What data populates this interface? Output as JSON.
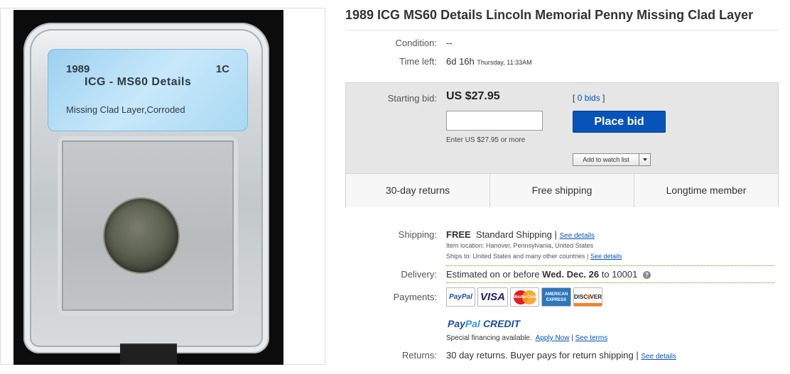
{
  "listing": {
    "title": "1989 ICG MS60 Details Lincoln Memorial Penny Missing Clad Layer"
  },
  "photo": {
    "label_year": "1989",
    "label_denomination": "1C",
    "label_grade": "ICG - MS60 Details",
    "label_note": "Missing Clad Layer,Corroded"
  },
  "condition": {
    "label": "Condition:",
    "value": "--"
  },
  "time_left": {
    "label": "Time left:",
    "value": "6d 16h",
    "end": "Thursday, 11:33AM"
  },
  "bid": {
    "label": "Starting bid:",
    "price": "US $27.95",
    "input_value": "",
    "hint": "Enter US $27.95 or more",
    "bids_open": "[",
    "bids_link": "0 bids",
    "bids_close": "]",
    "place_bid_label": "Place bid",
    "watch_label": "Add to watch list"
  },
  "features": [
    "30-day returns",
    "Free shipping",
    "Longtime member"
  ],
  "shipping": {
    "label": "Shipping:",
    "cost": "FREE",
    "method": "Standard Shipping |",
    "details_link": "See details",
    "location": "Item location:  Hanover, Pennsylvania, United States",
    "ships_to": "Ships to:  United States and many other countries |",
    "ships_to_link": "See details"
  },
  "delivery": {
    "label": "Delivery:",
    "prefix": "Estimated on or before",
    "date": "Wed. Dec. 26",
    "suffix": "to 10001",
    "help_icon": "?"
  },
  "payments": {
    "label": "Payments:",
    "cards": {
      "paypal": "PayPal",
      "visa": "VISA",
      "mastercard": "MasterCard",
      "amex_line1": "AMERICAN",
      "amex_line2": "EXPRESS",
      "discover_pre": "DISC",
      "discover_post": "VER"
    },
    "credit_logo_1": "Pay",
    "credit_logo_2": "Pal",
    "credit_logo_3": "CREDIT",
    "financing_text": "Special financing available.",
    "apply_link": "Apply Now",
    "separator": "|",
    "terms_link": "See terms"
  },
  "returns": {
    "label": "Returns:",
    "value": "30 day returns. Buyer pays for return shipping |",
    "details_link": "See details"
  },
  "colors": {
    "button_blue": "#0654ba",
    "link_blue": "#0654ba",
    "bid_panel_gray": "#e6e6e6",
    "dotted_green": "#5aa00a"
  }
}
